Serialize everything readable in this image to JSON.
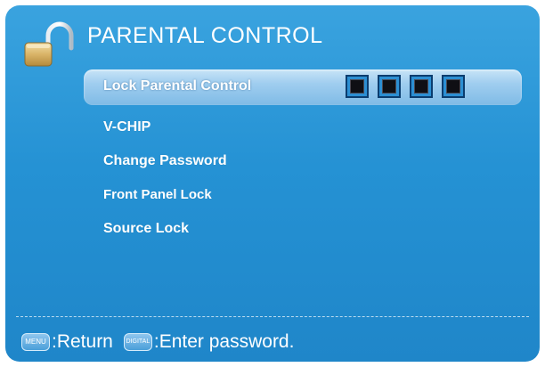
{
  "header": {
    "title": "PARENTAL CONTROL",
    "icon": "padlock-open-icon"
  },
  "menu": {
    "items": [
      {
        "label": "Lock Parental Control",
        "selected": true
      },
      {
        "label": "V-CHIP",
        "selected": false
      },
      {
        "label": "Change Password",
        "selected": false
      },
      {
        "label": "Front Panel Lock",
        "selected": false
      },
      {
        "label": "Source Lock",
        "selected": false
      }
    ],
    "pin_slots": 4
  },
  "footer": {
    "menu_key_label": "MENU",
    "menu_hint": ":Return",
    "digit_key_label": "DIGITAL",
    "digit_hint": ":Enter password."
  },
  "colors": {
    "background": "#2592d4",
    "highlight": "#9fcdef",
    "text": "#ffffff",
    "pin_border": "#0b3d6f"
  }
}
